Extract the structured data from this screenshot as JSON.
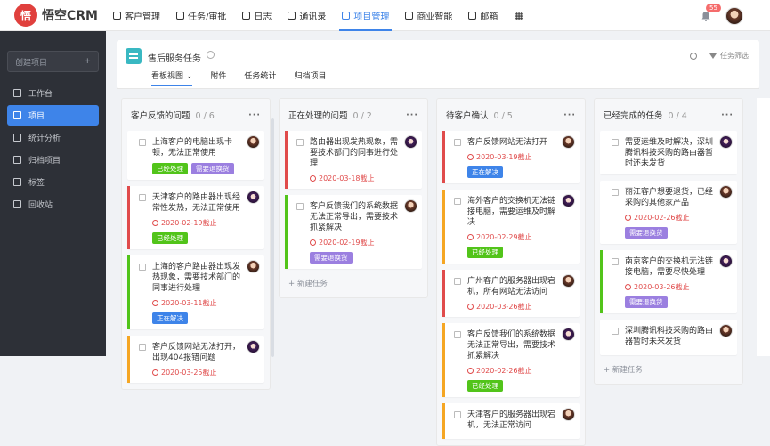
{
  "brand": {
    "name": "悟空CRM",
    "logo_char": "悟"
  },
  "nav": [
    {
      "label": "客户管理",
      "icon": "customer-icon",
      "active": false
    },
    {
      "label": "任务/审批",
      "icon": "briefcase-icon",
      "active": false
    },
    {
      "label": "日志",
      "icon": "log-icon",
      "active": false
    },
    {
      "label": "通讯录",
      "icon": "contacts-icon",
      "active": false
    },
    {
      "label": "项目管理",
      "icon": "project-icon",
      "active": true
    },
    {
      "label": "商业智能",
      "icon": "shield-icon",
      "active": false
    },
    {
      "label": "邮箱",
      "icon": "mail-icon",
      "active": false
    }
  ],
  "notifications": {
    "count": "55"
  },
  "sidebar": {
    "create_label": "创建项目",
    "create_plus": "+",
    "items": [
      {
        "label": "工作台",
        "icon": "desktop-icon",
        "active": false
      },
      {
        "label": "项目",
        "icon": "project-icon",
        "active": true
      },
      {
        "label": "统计分析",
        "icon": "chart-icon",
        "active": false
      },
      {
        "label": "归档项目",
        "icon": "archive-icon",
        "active": false
      },
      {
        "label": "标签",
        "icon": "tag-icon",
        "active": false
      },
      {
        "label": "回收站",
        "icon": "trash-icon",
        "active": false
      }
    ]
  },
  "project": {
    "title": "售后服务任务",
    "filter_label": "任务筛选",
    "tabs": [
      "看板视图",
      "附件",
      "任务统计",
      "归档项目"
    ]
  },
  "colors": {
    "accent": "#3e84e9",
    "green": "#52c41a",
    "orange": "#f5a623",
    "red": "#e04b4b",
    "purple": "#9b7fe0",
    "blue": "#3e84e9"
  },
  "columns": [
    {
      "title": "客户反馈的问题",
      "count": "0 / 6",
      "cards": [
        {
          "text": "上海客户的电脑出现卡顿，无法正常使用",
          "bar": "",
          "due": "",
          "tags": [
            {
              "label": "已经处理",
              "color": "#52c41a"
            },
            {
              "label": "需要退换货",
              "color": "#9b7fe0"
            }
          ]
        },
        {
          "text": "天津客户的路由器出现经常性发热，无法正常使用",
          "bar": "#e04b4b",
          "due": "2020-02-19截止",
          "tags": [
            {
              "label": "已经处理",
              "color": "#52c41a"
            }
          ]
        },
        {
          "text": "上海的客户路由器出现发热现象，需要技术部门的同事进行处理",
          "bar": "#52c41a",
          "due": "2020-03-11截止",
          "tags": [
            {
              "label": "正在解决",
              "color": "#3e84e9"
            }
          ]
        },
        {
          "text": "客户反馈网站无法打开，出现404报错问题",
          "bar": "#f5a623",
          "due": "2020-03-25截止",
          "tags": []
        }
      ],
      "add_label": ""
    },
    {
      "title": "正在处理的问题",
      "count": "0 / 2",
      "cards": [
        {
          "text": "路由器出现发热现象，需要技术部门的同事进行处理",
          "bar": "#e04b4b",
          "due": "2020-03-18截止",
          "tags": []
        },
        {
          "text": "客户反馈我们的系统数据无法正常导出，需要技术抓紧解决",
          "bar": "#52c41a",
          "due": "2020-02-19截止",
          "tags": [
            {
              "label": "需要退换货",
              "color": "#9b7fe0"
            }
          ]
        }
      ],
      "add_label": "+ 新建任务"
    },
    {
      "title": "待客户确认",
      "count": "0 / 5",
      "cards": [
        {
          "text": "客户反馈网站无法打开",
          "bar": "#e04b4b",
          "due": "2020-03-19截止",
          "tags": [
            {
              "label": "正在解决",
              "color": "#3e84e9"
            }
          ]
        },
        {
          "text": "海外客户的交换机无法链接电脑，需要运维及时解决",
          "bar": "#f5a623",
          "due": "2020-02-29截止",
          "tags": [
            {
              "label": "已经处理",
              "color": "#52c41a"
            }
          ]
        },
        {
          "text": "广州客户的服务器出现宕机，所有网站无法访问",
          "bar": "#e04b4b",
          "due": "2020-03-26截止",
          "tags": []
        },
        {
          "text": "客户反馈我们的系统数据无法正常导出，需要技术抓紧解决",
          "bar": "#f5a623",
          "due": "2020-02-26截止",
          "tags": [
            {
              "label": "已经处理",
              "color": "#52c41a"
            }
          ]
        },
        {
          "text": "天津客户的服务器出现宕机，无法正常访问",
          "bar": "#f5a623",
          "due": "",
          "tags": []
        }
      ],
      "add_label": ""
    },
    {
      "title": "已经完成的任务",
      "count": "0 / 4",
      "cards": [
        {
          "text": "需要运维及时解决，深圳腾讯科技采购的路由器暂时还未发货",
          "bar": "",
          "due": "",
          "tags": []
        },
        {
          "text": "丽江客户想要退货，已经采购的其他家产品",
          "bar": "",
          "due": "2020-02-26截止",
          "tags": [
            {
              "label": "需要退换货",
              "color": "#9b7fe0"
            }
          ]
        },
        {
          "text": "南京客户的交换机无法链接电脑，需要尽快处理",
          "bar": "#52c41a",
          "due": "2020-03-26截止",
          "tags": [
            {
              "label": "需要退换货",
              "color": "#9b7fe0"
            }
          ]
        },
        {
          "text": "深圳腾讯科技采购的路由器暂时未来发货",
          "bar": "",
          "due": "",
          "tags": []
        }
      ],
      "add_label": "+ 新建任务"
    }
  ]
}
